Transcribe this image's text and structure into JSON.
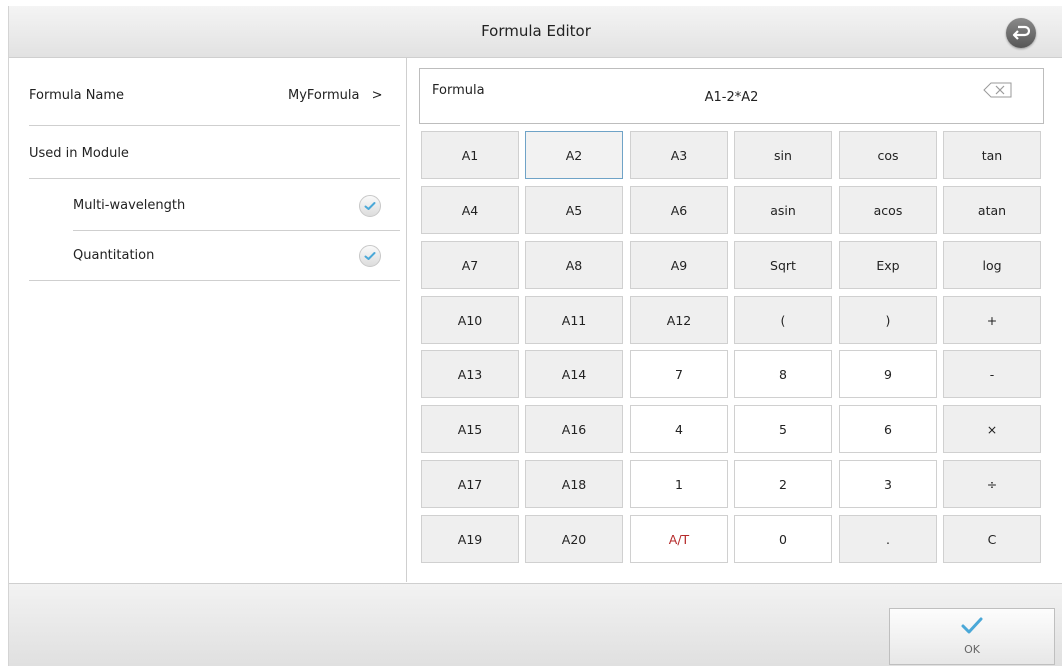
{
  "window": {
    "title": "Formula Editor"
  },
  "left_panel": {
    "formula_name_label": "Formula Name",
    "formula_name_value": "MyFormula",
    "formula_name_arrow": ">",
    "used_in_module_label": "Used in Module",
    "modules": [
      {
        "label": "Multi-wavelength",
        "checked": true
      },
      {
        "label": "Quantitation",
        "checked": true
      }
    ]
  },
  "formula": {
    "label": "Formula",
    "value": "A1-2*A2"
  },
  "keypad": {
    "keys": [
      [
        "A1",
        "A2",
        "A3",
        "sin",
        "cos",
        "tan"
      ],
      [
        "A4",
        "A5",
        "A6",
        "asin",
        "acos",
        "atan"
      ],
      [
        "A7",
        "A8",
        "A9",
        "Sqrt",
        "Exp",
        "log"
      ],
      [
        "A10",
        "A11",
        "A12",
        "(",
        ")",
        "+"
      ],
      [
        "A13",
        "A14",
        "7",
        "8",
        "9",
        "-"
      ],
      [
        "A15",
        "A16",
        "4",
        "5",
        "6",
        "×"
      ],
      [
        "A17",
        "A18",
        "1",
        "2",
        "3",
        "÷"
      ],
      [
        "A19",
        "A20",
        "A/T",
        "0",
        ".",
        "C"
      ]
    ],
    "selected_key": "A2"
  },
  "bottom": {
    "ok_label": "OK"
  },
  "colors": {
    "accent": "#4aa8d8",
    "highlight_red": "#b52a2a",
    "selected_border": "#6fa3c7"
  },
  "icons": {
    "back": "back-arrow-icon",
    "clear": "backspace-icon",
    "check": "checkmark-icon"
  }
}
